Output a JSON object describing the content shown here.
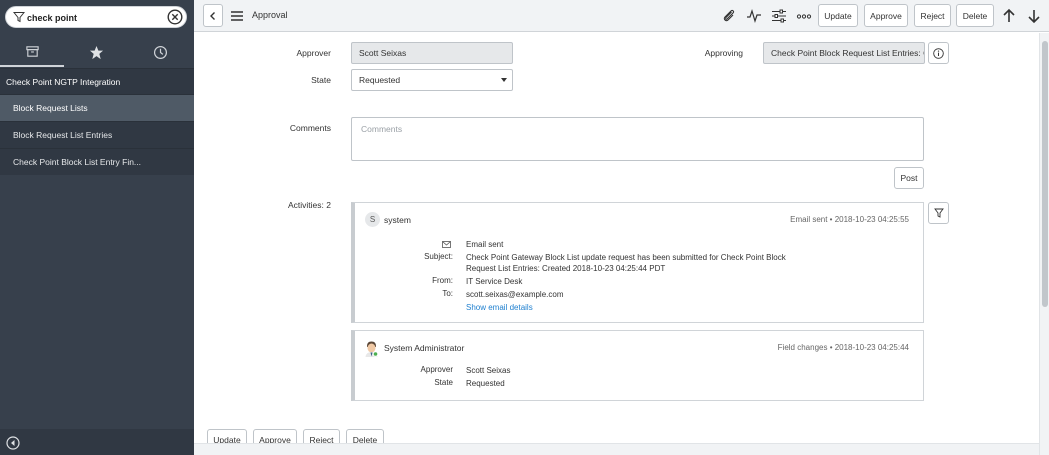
{
  "sidebar": {
    "filter_value": "check point",
    "tabs": [
      {
        "name": "all-apps-tab",
        "icon": "archive-icon"
      },
      {
        "name": "favorites-tab",
        "icon": "star-icon"
      },
      {
        "name": "history-tab",
        "icon": "clock-icon"
      }
    ],
    "module": "Check Point NGTP Integration",
    "items": [
      {
        "label": "Block Request Lists",
        "active": true
      },
      {
        "label": "Block Request List Entries",
        "active": false
      },
      {
        "label": "Check Point Block List Entry Fin...",
        "active": false
      }
    ]
  },
  "header": {
    "title": "Approval",
    "buttons": {
      "update": "Update",
      "approve": "Approve",
      "reject": "Reject",
      "delete": "Delete"
    },
    "icons": [
      "back-icon",
      "menu-icon",
      "attachment-icon",
      "activity-icon",
      "personalize-icon",
      "more-icon",
      "up-arrow-icon",
      "down-arrow-icon"
    ]
  },
  "form": {
    "approver_label": "Approver",
    "approver_value": "Scott Seixas",
    "approving_label": "Approving",
    "approving_value": "Check Point Block Request List Entries: C",
    "state_label": "State",
    "state_value": "Requested",
    "comments_label": "Comments",
    "comments_placeholder": "Comments",
    "post_label": "Post",
    "activities_label": "Activities: 2"
  },
  "activities": [
    {
      "avatar_letter": "S",
      "user": "system",
      "meta": "Email sent  •  2018-10-23 04:25:55",
      "email_header": "Email sent",
      "subject_key": "Subject:",
      "subject_line1": "Check Point Gateway Block List update request has been submitted for Check Point Block",
      "subject_line2": "Request List Entries: Created 2018-10-23 04:25:44 PDT",
      "from_key": "From:",
      "from_val": "IT Service Desk",
      "to_key": "To:",
      "to_val": "scott.seixas@example.com",
      "link": "Show email details"
    },
    {
      "user": "System Administrator",
      "meta": "Field changes  •  2018-10-23 04:25:44",
      "fields": [
        {
          "key": "Approver",
          "val": "Scott Seixas"
        },
        {
          "key": "State",
          "val": "Requested"
        }
      ]
    }
  ],
  "footer_buttons": {
    "update": "Update",
    "approve": "Approve",
    "reject": "Reject",
    "delete": "Delete"
  },
  "colors": {
    "sidebar_bg": "#37404c",
    "active_item": "#4f5a66",
    "link": "#1e7fcf"
  }
}
